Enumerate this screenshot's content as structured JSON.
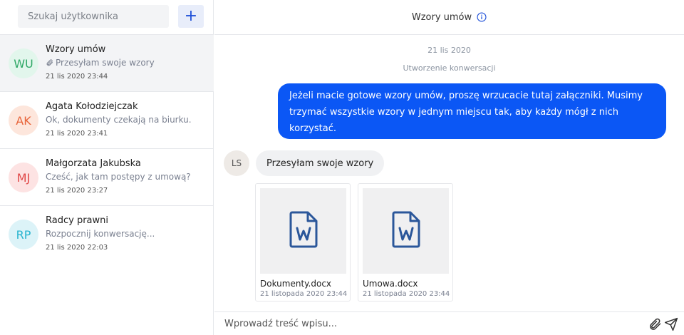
{
  "sidebar": {
    "search": {
      "placeholder": "Szukaj użytkownika",
      "value": ""
    },
    "add_button": {
      "label": "+",
      "icon": "plus-icon"
    },
    "conversations": [
      {
        "initials": "WU",
        "name": "Wzory umów",
        "preview": "Przesyłam swoje wzory",
        "preview_icon": "paperclip-icon",
        "time": "21 lis 2020 23:44",
        "avatar_bg": "#e2f6ec",
        "avatar_color": "#2fa866",
        "active": true
      },
      {
        "initials": "AK",
        "name": "Agata Kołodziejczak",
        "preview": "Ok, dokumenty czekają na biurku.",
        "time": "21 lis 2020 23:41",
        "avatar_bg": "#fde6dc",
        "avatar_color": "#e8643a",
        "active": false
      },
      {
        "initials": "MJ",
        "name": "Małgorzata Jakubska",
        "preview": "Cześć, jak tam postępy z umową?",
        "time": "21 lis 2020 23:27",
        "avatar_bg": "#fde3e3",
        "avatar_color": "#e04848",
        "active": false
      },
      {
        "initials": "RP",
        "name": "Radcy prawni",
        "preview": "Rozpocznij konwersację...",
        "time": "21 lis 2020 22:03",
        "avatar_bg": "#dcf3f8",
        "avatar_color": "#27b4cf",
        "active": false
      }
    ]
  },
  "chat": {
    "title": "Wzory umów",
    "title_icon": "info-icon",
    "date_divider": "21 lis 2020",
    "system_event": "Utworzenie konwersacji",
    "outgoing_message": "Jeżeli macie gotowe wzory umów, proszę wrzucacie tutaj załączniki. Musimy trzymać wszystkie wzory w jednym miejscu tak, aby każdy mógł z nich korzystać.",
    "incoming": {
      "sender_initials": "LS",
      "message": "Przesyłam swoje wzory",
      "attachments": [
        {
          "name": "Dokumenty.docx",
          "date": "21 listopada 2020 23:44",
          "icon": "word-document-icon"
        },
        {
          "name": "Umowa.docx",
          "date": "21 listopada 2020 23:44",
          "icon": "word-document-icon"
        }
      ]
    },
    "composer": {
      "placeholder": "Wprowadź treść wpisu...",
      "value": "",
      "attach_icon": "paperclip-icon",
      "send_icon": "send-icon"
    }
  },
  "colors": {
    "accent": "#0b57f5",
    "add_button_bg": "#e8edfa",
    "active_row_bg": "#f3f4f6",
    "doc_icon": "#2b579a"
  }
}
